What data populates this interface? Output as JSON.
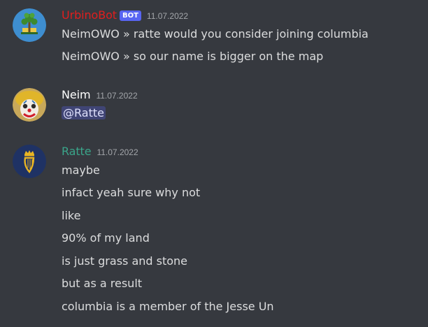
{
  "colors": {
    "background": "#36393f",
    "message_text": "#dcddde",
    "timestamp": "#a3a6aa",
    "bot_tag_bg": "#5865f2",
    "urbinobot_name": "#e01e1e",
    "neim_name": "#ffffff",
    "ratte_name": "#3aa58a",
    "mention_bg": "#4a4f85"
  },
  "messages": [
    {
      "author": "UrbinoBot",
      "bot_tag": "BOT",
      "timestamp": "11.07.2022",
      "avatar_icon": "tree-flag-icon",
      "lines": [
        "NeimOWO » ratte would you consider joining columbia",
        "NeimOWO » so our name is bigger on the map"
      ]
    },
    {
      "author": "Neim",
      "timestamp": "11.07.2022",
      "avatar_icon": "clown-face-icon",
      "lines": [
        "@Ratte"
      ]
    },
    {
      "author": "Ratte",
      "timestamp": "11.07.2022",
      "avatar_icon": "crowned-harp-icon",
      "lines": [
        "maybe",
        "infact yeah sure why not",
        "like",
        "90% of my land",
        "is just grass and stone",
        "but as a result",
        "columbia is a member of the Jesse Un"
      ]
    }
  ]
}
